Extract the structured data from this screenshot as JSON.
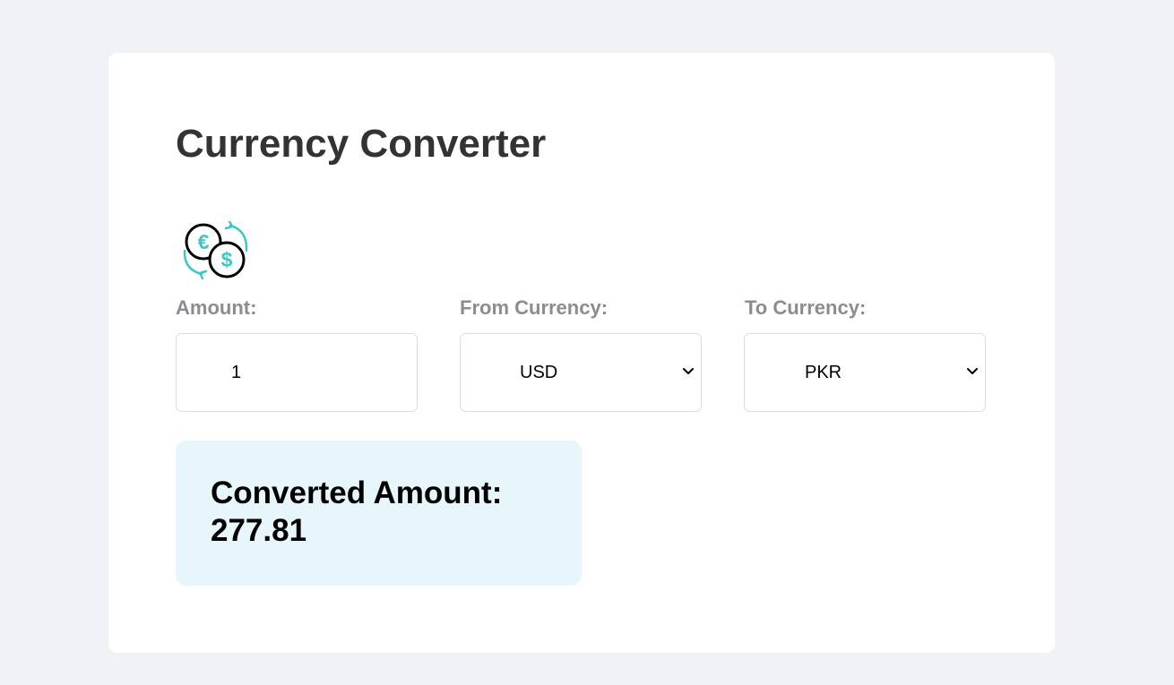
{
  "page": {
    "title": "Currency Converter"
  },
  "logo": {
    "icon": "currency-exchange-icon",
    "symbols": [
      "€",
      "$"
    ],
    "accent_color": "#3cc8c8"
  },
  "form": {
    "amount": {
      "label": "Amount:",
      "value": "1"
    },
    "from_currency": {
      "label": "From Currency:",
      "selected": "USD"
    },
    "to_currency": {
      "label": "To Currency:",
      "selected": "PKR"
    }
  },
  "result": {
    "label": "Converted Amount:",
    "value": "277.81"
  },
  "colors": {
    "background": "#f0f2f5",
    "card": "#ffffff",
    "title": "#333333",
    "label": "#8c8c92",
    "result_background": "#e6f6fb"
  }
}
